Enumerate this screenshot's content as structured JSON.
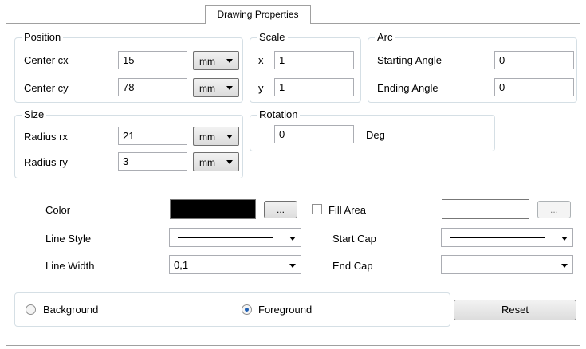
{
  "tab": {
    "label": "Drawing Properties"
  },
  "position": {
    "legend": "Position",
    "cx_label": "Center cx",
    "cx_value": "15",
    "cx_unit": "mm",
    "cy_label": "Center cy",
    "cy_value": "78",
    "cy_unit": "mm"
  },
  "scale": {
    "legend": "Scale",
    "x_label": "x",
    "x_value": "1",
    "y_label": "y",
    "y_value": "1"
  },
  "arc": {
    "legend": "Arc",
    "start_label": "Starting Angle",
    "start_value": "0",
    "end_label": "Ending Angle",
    "end_value": "0"
  },
  "size": {
    "legend": "Size",
    "rx_label": "Radius rx",
    "rx_value": "21",
    "rx_unit": "mm",
    "ry_label": "Radius ry",
    "ry_value": "3",
    "ry_unit": "mm"
  },
  "rotation": {
    "legend": "Rotation",
    "value": "0",
    "unit": "Deg"
  },
  "style": {
    "color_label": "Color",
    "color_value": "#000000",
    "browse_label": "...",
    "fill_label": "Fill Area",
    "fill_checked": false,
    "fill_color": "#ffffff",
    "fill_browse_label": "...",
    "line_style_label": "Line Style",
    "line_width_label": "Line Width",
    "line_width_value": "0,1",
    "start_cap_label": "Start Cap",
    "end_cap_label": "End Cap"
  },
  "layer": {
    "background_label": "Background",
    "background_selected": false,
    "foreground_label": "Foreground",
    "foreground_selected": true
  },
  "reset_label": "Reset",
  "colors": {
    "radio_dot": "#1e5fb4",
    "border": "#a0a0a0"
  }
}
